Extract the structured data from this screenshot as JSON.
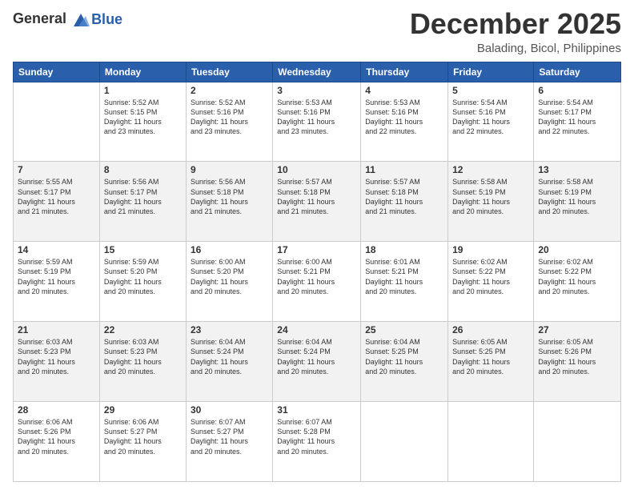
{
  "header": {
    "logo_general": "General",
    "logo_blue": "Blue",
    "month": "December 2025",
    "location": "Balading, Bicol, Philippines"
  },
  "weekdays": [
    "Sunday",
    "Monday",
    "Tuesday",
    "Wednesday",
    "Thursday",
    "Friday",
    "Saturday"
  ],
  "weeks": [
    [
      {
        "day": "",
        "sunrise": "",
        "sunset": "",
        "daylight": ""
      },
      {
        "day": "1",
        "sunrise": "Sunrise: 5:52 AM",
        "sunset": "Sunset: 5:15 PM",
        "daylight": "Daylight: 11 hours and 23 minutes."
      },
      {
        "day": "2",
        "sunrise": "Sunrise: 5:52 AM",
        "sunset": "Sunset: 5:16 PM",
        "daylight": "Daylight: 11 hours and 23 minutes."
      },
      {
        "day": "3",
        "sunrise": "Sunrise: 5:53 AM",
        "sunset": "Sunset: 5:16 PM",
        "daylight": "Daylight: 11 hours and 23 minutes."
      },
      {
        "day": "4",
        "sunrise": "Sunrise: 5:53 AM",
        "sunset": "Sunset: 5:16 PM",
        "daylight": "Daylight: 11 hours and 22 minutes."
      },
      {
        "day": "5",
        "sunrise": "Sunrise: 5:54 AM",
        "sunset": "Sunset: 5:16 PM",
        "daylight": "Daylight: 11 hours and 22 minutes."
      },
      {
        "day": "6",
        "sunrise": "Sunrise: 5:54 AM",
        "sunset": "Sunset: 5:17 PM",
        "daylight": "Daylight: 11 hours and 22 minutes."
      }
    ],
    [
      {
        "day": "7",
        "sunrise": "Sunrise: 5:55 AM",
        "sunset": "Sunset: 5:17 PM",
        "daylight": "Daylight: 11 hours and 21 minutes."
      },
      {
        "day": "8",
        "sunrise": "Sunrise: 5:56 AM",
        "sunset": "Sunset: 5:17 PM",
        "daylight": "Daylight: 11 hours and 21 minutes."
      },
      {
        "day": "9",
        "sunrise": "Sunrise: 5:56 AM",
        "sunset": "Sunset: 5:18 PM",
        "daylight": "Daylight: 11 hours and 21 minutes."
      },
      {
        "day": "10",
        "sunrise": "Sunrise: 5:57 AM",
        "sunset": "Sunset: 5:18 PM",
        "daylight": "Daylight: 11 hours and 21 minutes."
      },
      {
        "day": "11",
        "sunrise": "Sunrise: 5:57 AM",
        "sunset": "Sunset: 5:18 PM",
        "daylight": "Daylight: 11 hours and 21 minutes."
      },
      {
        "day": "12",
        "sunrise": "Sunrise: 5:58 AM",
        "sunset": "Sunset: 5:19 PM",
        "daylight": "Daylight: 11 hours and 20 minutes."
      },
      {
        "day": "13",
        "sunrise": "Sunrise: 5:58 AM",
        "sunset": "Sunset: 5:19 PM",
        "daylight": "Daylight: 11 hours and 20 minutes."
      }
    ],
    [
      {
        "day": "14",
        "sunrise": "Sunrise: 5:59 AM",
        "sunset": "Sunset: 5:19 PM",
        "daylight": "Daylight: 11 hours and 20 minutes."
      },
      {
        "day": "15",
        "sunrise": "Sunrise: 5:59 AM",
        "sunset": "Sunset: 5:20 PM",
        "daylight": "Daylight: 11 hours and 20 minutes."
      },
      {
        "day": "16",
        "sunrise": "Sunrise: 6:00 AM",
        "sunset": "Sunset: 5:20 PM",
        "daylight": "Daylight: 11 hours and 20 minutes."
      },
      {
        "day": "17",
        "sunrise": "Sunrise: 6:00 AM",
        "sunset": "Sunset: 5:21 PM",
        "daylight": "Daylight: 11 hours and 20 minutes."
      },
      {
        "day": "18",
        "sunrise": "Sunrise: 6:01 AM",
        "sunset": "Sunset: 5:21 PM",
        "daylight": "Daylight: 11 hours and 20 minutes."
      },
      {
        "day": "19",
        "sunrise": "Sunrise: 6:02 AM",
        "sunset": "Sunset: 5:22 PM",
        "daylight": "Daylight: 11 hours and 20 minutes."
      },
      {
        "day": "20",
        "sunrise": "Sunrise: 6:02 AM",
        "sunset": "Sunset: 5:22 PM",
        "daylight": "Daylight: 11 hours and 20 minutes."
      }
    ],
    [
      {
        "day": "21",
        "sunrise": "Sunrise: 6:03 AM",
        "sunset": "Sunset: 5:23 PM",
        "daylight": "Daylight: 11 hours and 20 minutes."
      },
      {
        "day": "22",
        "sunrise": "Sunrise: 6:03 AM",
        "sunset": "Sunset: 5:23 PM",
        "daylight": "Daylight: 11 hours and 20 minutes."
      },
      {
        "day": "23",
        "sunrise": "Sunrise: 6:04 AM",
        "sunset": "Sunset: 5:24 PM",
        "daylight": "Daylight: 11 hours and 20 minutes."
      },
      {
        "day": "24",
        "sunrise": "Sunrise: 6:04 AM",
        "sunset": "Sunset: 5:24 PM",
        "daylight": "Daylight: 11 hours and 20 minutes."
      },
      {
        "day": "25",
        "sunrise": "Sunrise: 6:04 AM",
        "sunset": "Sunset: 5:25 PM",
        "daylight": "Daylight: 11 hours and 20 minutes."
      },
      {
        "day": "26",
        "sunrise": "Sunrise: 6:05 AM",
        "sunset": "Sunset: 5:25 PM",
        "daylight": "Daylight: 11 hours and 20 minutes."
      },
      {
        "day": "27",
        "sunrise": "Sunrise: 6:05 AM",
        "sunset": "Sunset: 5:26 PM",
        "daylight": "Daylight: 11 hours and 20 minutes."
      }
    ],
    [
      {
        "day": "28",
        "sunrise": "Sunrise: 6:06 AM",
        "sunset": "Sunset: 5:26 PM",
        "daylight": "Daylight: 11 hours and 20 minutes."
      },
      {
        "day": "29",
        "sunrise": "Sunrise: 6:06 AM",
        "sunset": "Sunset: 5:27 PM",
        "daylight": "Daylight: 11 hours and 20 minutes."
      },
      {
        "day": "30",
        "sunrise": "Sunrise: 6:07 AM",
        "sunset": "Sunset: 5:27 PM",
        "daylight": "Daylight: 11 hours and 20 minutes."
      },
      {
        "day": "31",
        "sunrise": "Sunrise: 6:07 AM",
        "sunset": "Sunset: 5:28 PM",
        "daylight": "Daylight: 11 hours and 20 minutes."
      },
      {
        "day": "",
        "sunrise": "",
        "sunset": "",
        "daylight": ""
      },
      {
        "day": "",
        "sunrise": "",
        "sunset": "",
        "daylight": ""
      },
      {
        "day": "",
        "sunrise": "",
        "sunset": "",
        "daylight": ""
      }
    ]
  ]
}
